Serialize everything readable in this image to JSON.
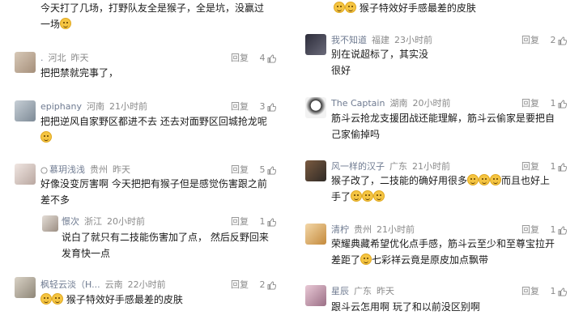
{
  "left": {
    "top_text": {
      "line1": "今天打了几场，打野队友全是猴子，全是坑，没赢过",
      "line2": "一场"
    },
    "c1": {
      "user": ".",
      "loc": "河北",
      "time": "昨天",
      "reply": "回复",
      "likes": "4",
      "text": "把把禁就完事了，"
    },
    "c2": {
      "user": "epiphany",
      "loc": "河南",
      "time": "21小时前",
      "reply": "回复",
      "likes": "3",
      "line1": "把把逆风自家野区都进不去 还去对面野区回城抢龙呢",
      "line2": ""
    },
    "c3": {
      "user": "慕玥浅浅",
      "loc": "贵州",
      "time": "昨天",
      "reply": "回复",
      "likes": "5",
      "line1": "好像没变厉害啊 今天把把有猴子但是感觉伤害跟之前",
      "line2": "差不多"
    },
    "c3_reply": {
      "user": "憬次",
      "loc": "浙江",
      "time": "20小时前",
      "reply": "回复",
      "likes": "1",
      "line1": "说白了就只有二技能伤害加了点， 然后反野回来",
      "line2": "发育快一点"
    },
    "c4": {
      "user": "枫轻云淡（H...",
      "loc": "云南",
      "time": "22小时前",
      "reply": "回复",
      "likes": "2",
      "text": "猴子特效好手感最差的皮肤"
    }
  },
  "right": {
    "top_text": "猴子特效好手感最差的皮肤",
    "c1": {
      "user": "我不知道",
      "loc": "福建",
      "time": "23小时前",
      "reply": "回复",
      "likes": "2",
      "line1": "别在说超标了，其实没",
      "line2": "很好"
    },
    "c2": {
      "user": "The Captain",
      "loc": "湖南",
      "time": "20小时前",
      "reply": "回复",
      "likes": "1",
      "line1": "筋斗云抢龙支援团战还能理解，筋斗云偷家是要把自",
      "line2": "己家偷掉吗"
    },
    "c3": {
      "user": "风一样的汉子",
      "loc": "广东",
      "time": "21小时前",
      "reply": "回复",
      "likes": "1",
      "line1": "猴子改了，二技能的确好用很多",
      "line1b": "而且也好上",
      "line2": "手了"
    },
    "c4": {
      "user": "清柠",
      "loc": "贵州",
      "time": "21小时前",
      "reply": "回复",
      "likes": "1",
      "line1": "荣耀典藏希望优化点手感，筋斗云至少和至尊宝拉开",
      "line2": "差距了",
      "line2b": "七彩祥云竟是原皮加点飘带"
    },
    "c5": {
      "user": "星辰",
      "loc": "广东",
      "time": "昨天",
      "reply": "回复",
      "likes": "1",
      "text": "跟斗云怎用啊  玩了和以前没区别啊"
    }
  },
  "colors": {
    "username": "#6f7b91",
    "meta": "#8a8a8a",
    "text": "#1a1a1a",
    "emoji": "#f5c542"
  },
  "icons": [
    "thumb-up-icon",
    "laugh-emoji-icon",
    "grin-emoji-icon",
    "verified-tag-icon"
  ]
}
